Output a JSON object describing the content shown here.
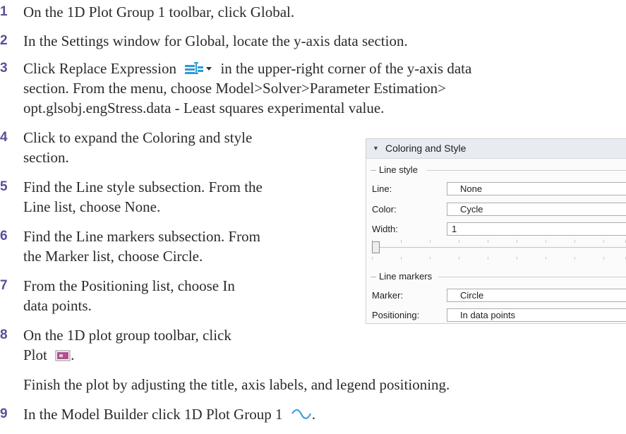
{
  "steps": [
    {
      "num": "1",
      "text": "On the 1D Plot Group 1 toolbar, click Global."
    },
    {
      "num": "2",
      "text": "In the Settings window for Global, locate the y-axis data section."
    },
    {
      "num": "3",
      "line1_before": "Click Replace Expression",
      "line1_after": "in the upper-right corner of the y-axis data",
      "line2": "section. From the menu, choose Model>Solver>Parameter Estimation>",
      "line3": "opt.glsobj.engStress.data - Least squares experimental value."
    },
    {
      "num": "4",
      "line1": "Click to expand the Coloring and style",
      "line2": "section."
    },
    {
      "num": "5",
      "line1": "Find the Line style subsection. From the",
      "line2": "Line list, choose None."
    },
    {
      "num": "6",
      "line1": "Find the Line markers subsection. From",
      "line2": "the Marker list, choose Circle."
    },
    {
      "num": "7",
      "line1": "From the Positioning list, choose In",
      "line2": "data points."
    },
    {
      "num": "8",
      "line1": "On the 1D plot group toolbar, click",
      "line2": "Plot"
    },
    {
      "num": "",
      "text": "Finish the plot by adjusting the title, axis labels, and legend positioning."
    },
    {
      "num": "9",
      "text": "In the Model Builder click 1D Plot Group 1"
    }
  ],
  "icons": {
    "replace_expression": "replace-expression-icon",
    "plot": "plot-icon",
    "plot_group": "1d-plot-group-icon"
  },
  "panel": {
    "title": "Coloring and Style",
    "line_style_label": "Line style",
    "line_label": "Line:",
    "line_value": "None",
    "color_label": "Color:",
    "color_value": "Cycle",
    "width_label": "Width:",
    "width_value": "1",
    "line_markers_label": "Line markers",
    "marker_label": "Marker:",
    "marker_value": "Circle",
    "positioning_label": "Positioning:",
    "positioning_value": "In data points"
  },
  "colors": {
    "step_number": "#5b4d9a",
    "icon_blue": "#2e9bd6",
    "icon_purple": "#b0508f"
  }
}
